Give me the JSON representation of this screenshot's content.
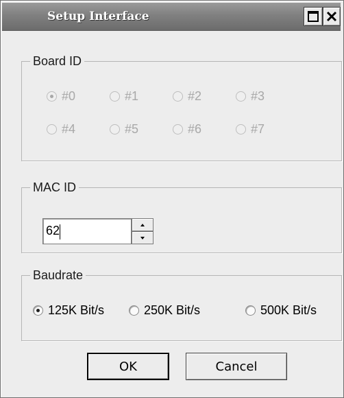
{
  "window": {
    "title": "Setup Interface",
    "maximize_icon": "maximize-icon",
    "close_icon": "close-icon"
  },
  "board_id": {
    "legend": "Board ID",
    "enabled": false,
    "selected": "#0",
    "options": [
      "#0",
      "#1",
      "#2",
      "#3",
      "#4",
      "#5",
      "#6",
      "#7"
    ]
  },
  "mac_id": {
    "legend": "MAC ID",
    "value": "62"
  },
  "baudrate": {
    "legend": "Baudrate",
    "selected": "125K Bit/s",
    "options": [
      "125K Bit/s",
      "250K Bit/s",
      "500K Bit/s"
    ]
  },
  "buttons": {
    "ok": "OK",
    "cancel": "Cancel"
  }
}
